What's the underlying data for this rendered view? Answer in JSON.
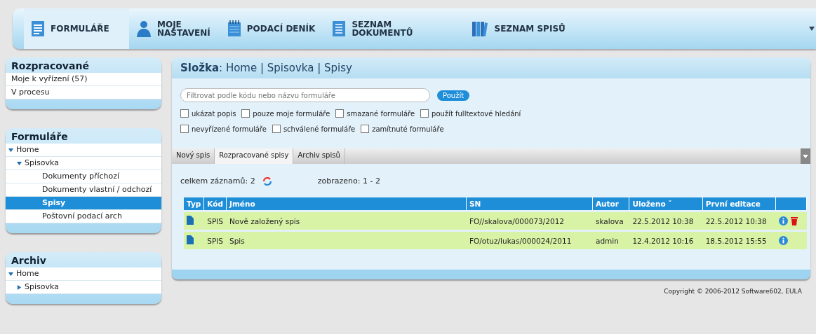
{
  "nav": {
    "items": [
      {
        "label": "FORMULÁŘE",
        "kind": "form",
        "selected": true
      },
      {
        "label": "MOJE\nNASTAVENÍ",
        "kind": "user",
        "selected": false
      },
      {
        "label": "PODACÍ DENÍK",
        "kind": "calendar",
        "selected": false
      },
      {
        "label": "SEZNAM\nDOKUMENTŮ",
        "kind": "list",
        "selected": false
      },
      {
        "label": "SEZNAM SPISŮ",
        "kind": "books",
        "selected": false
      }
    ]
  },
  "sidebar": [
    {
      "title": "Rozpracované",
      "items": [
        {
          "label": "Moje k vyřízení (57)",
          "selected": false
        },
        {
          "label": "V procesu",
          "selected": false
        }
      ]
    },
    {
      "title": "Formuláře",
      "tree": [
        {
          "label": "Home",
          "expanded": true,
          "selected": false,
          "children": [
            {
              "label": "Spisovka",
              "expanded": true,
              "selected": false,
              "children": [
                {
                  "label": "Dokumenty příchozí",
                  "selected": false
                },
                {
                  "label": "Dokumenty vlastní / odchozí",
                  "selected": false
                },
                {
                  "label": "Spisy",
                  "selected": true
                },
                {
                  "label": "Poštovní podací arch",
                  "selected": false
                }
              ]
            }
          ]
        }
      ]
    },
    {
      "title": "Archiv",
      "tree": [
        {
          "label": "Home",
          "expanded": true,
          "selected": false,
          "children": [
            {
              "label": "Spisovka",
              "expanded": false,
              "selected": false
            }
          ]
        }
      ]
    }
  ],
  "main": {
    "folder": "**Složka**: Home | Spisovka | Spisy",
    "filter": {
      "placeholder": "Filtrovat podle kódu nebo názvu formuláře",
      "button": "Použít"
    },
    "checkbox_rows": [
      [
        {
          "label": "ukázat popis",
          "checked": false
        },
        {
          "label": "pouze moje formuláře",
          "checked": false
        },
        {
          "label": "smazané formuláře",
          "checked": false
        },
        {
          "label": "použít fulltextové hledání",
          "checked": false
        }
      ],
      [
        {
          "label": "nevyřízené formuláře",
          "checked": false
        },
        {
          "label": "schválené formuláře",
          "checked": false
        },
        {
          "label": "zamítnuté formuláře",
          "checked": false
        }
      ]
    ],
    "tabs": [
      {
        "label": "Nový spis",
        "selected": false
      },
      {
        "label": "Rozpracované spisy",
        "selected": true
      },
      {
        "label": "Archiv spisů",
        "selected": false
      }
    ],
    "total": "celkem záznamů: 2",
    "shown": "zobrazeno: 1 - 2",
    "table": {
      "columns": [
        "Typ",
        "Kód",
        "Jméno",
        "SN",
        "Autor",
        "Uloženo ˇ",
        "První editace"
      ],
      "rows": [
        {
          "code": "SPIS",
          "name": "Nově založený spis",
          "sn": "FO//skalova/000073/2012",
          "author": "skalova",
          "saved": "22.5.2012 10:38",
          "first_edit": "22.5.2012 10:38",
          "deletable": true
        },
        {
          "code": "SPIS",
          "name": "Spis",
          "sn": "FO/otuz/lukas/000024/2011",
          "author": "admin",
          "saved": "12.4.2012 10:16",
          "first_edit": "18.5.2012 15:55",
          "deletable": false
        }
      ]
    }
  },
  "footer": "Copyright © 2006-2012 Software602, EULA"
}
